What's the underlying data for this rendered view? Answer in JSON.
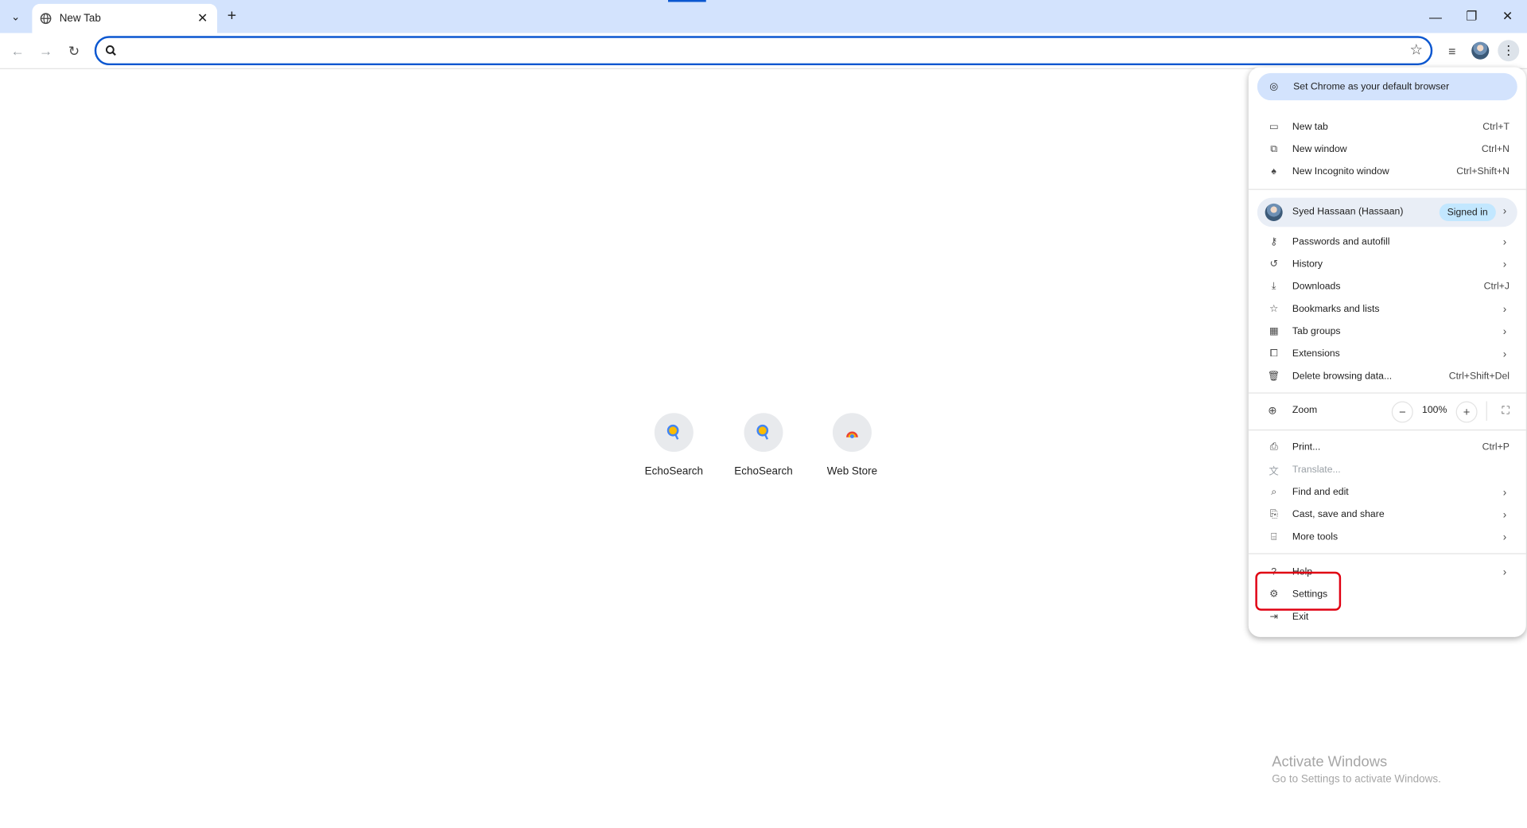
{
  "browser": {
    "tab": {
      "title": "New Tab"
    },
    "omnibox": {
      "value": "",
      "placeholder": ""
    }
  },
  "shortcuts": [
    {
      "label": "EchoSearch",
      "icon": "echosearch-icon"
    },
    {
      "label": "EchoSearch",
      "icon": "echosearch-icon"
    },
    {
      "label": "Web Store",
      "icon": "web-store-icon"
    }
  ],
  "menu": {
    "default_banner": "Set Chrome as your default browser",
    "new_tab": {
      "label": "New tab",
      "shortcut": "Ctrl+T"
    },
    "new_window": {
      "label": "New window",
      "shortcut": "Ctrl+N"
    },
    "incognito": {
      "label": "New Incognito window",
      "shortcut": "Ctrl+Shift+N"
    },
    "profile": {
      "name": "Syed Hassaan (Hassaan)",
      "status": "Signed in"
    },
    "passwords": {
      "label": "Passwords and autofill"
    },
    "history": {
      "label": "History"
    },
    "downloads": {
      "label": "Downloads",
      "shortcut": "Ctrl+J"
    },
    "bookmarks": {
      "label": "Bookmarks and lists"
    },
    "tab_groups": {
      "label": "Tab groups"
    },
    "extensions": {
      "label": "Extensions"
    },
    "delete_data": {
      "label": "Delete browsing data...",
      "shortcut": "Ctrl+Shift+Del"
    },
    "zoom": {
      "label": "Zoom",
      "value": "100%"
    },
    "print": {
      "label": "Print...",
      "shortcut": "Ctrl+P"
    },
    "translate": {
      "label": "Translate..."
    },
    "find_edit": {
      "label": "Find and edit"
    },
    "cast": {
      "label": "Cast, save and share"
    },
    "more_tools": {
      "label": "More tools"
    },
    "help": {
      "label": "Help"
    },
    "settings": {
      "label": "Settings"
    },
    "exit": {
      "label": "Exit"
    }
  },
  "watermark": {
    "title": "Activate Windows",
    "subtitle": "Go to Settings to activate Windows."
  },
  "colors": {
    "accent": "#0b57d0",
    "titlebar": "#d3e3fd",
    "highlight": "#e00012"
  }
}
